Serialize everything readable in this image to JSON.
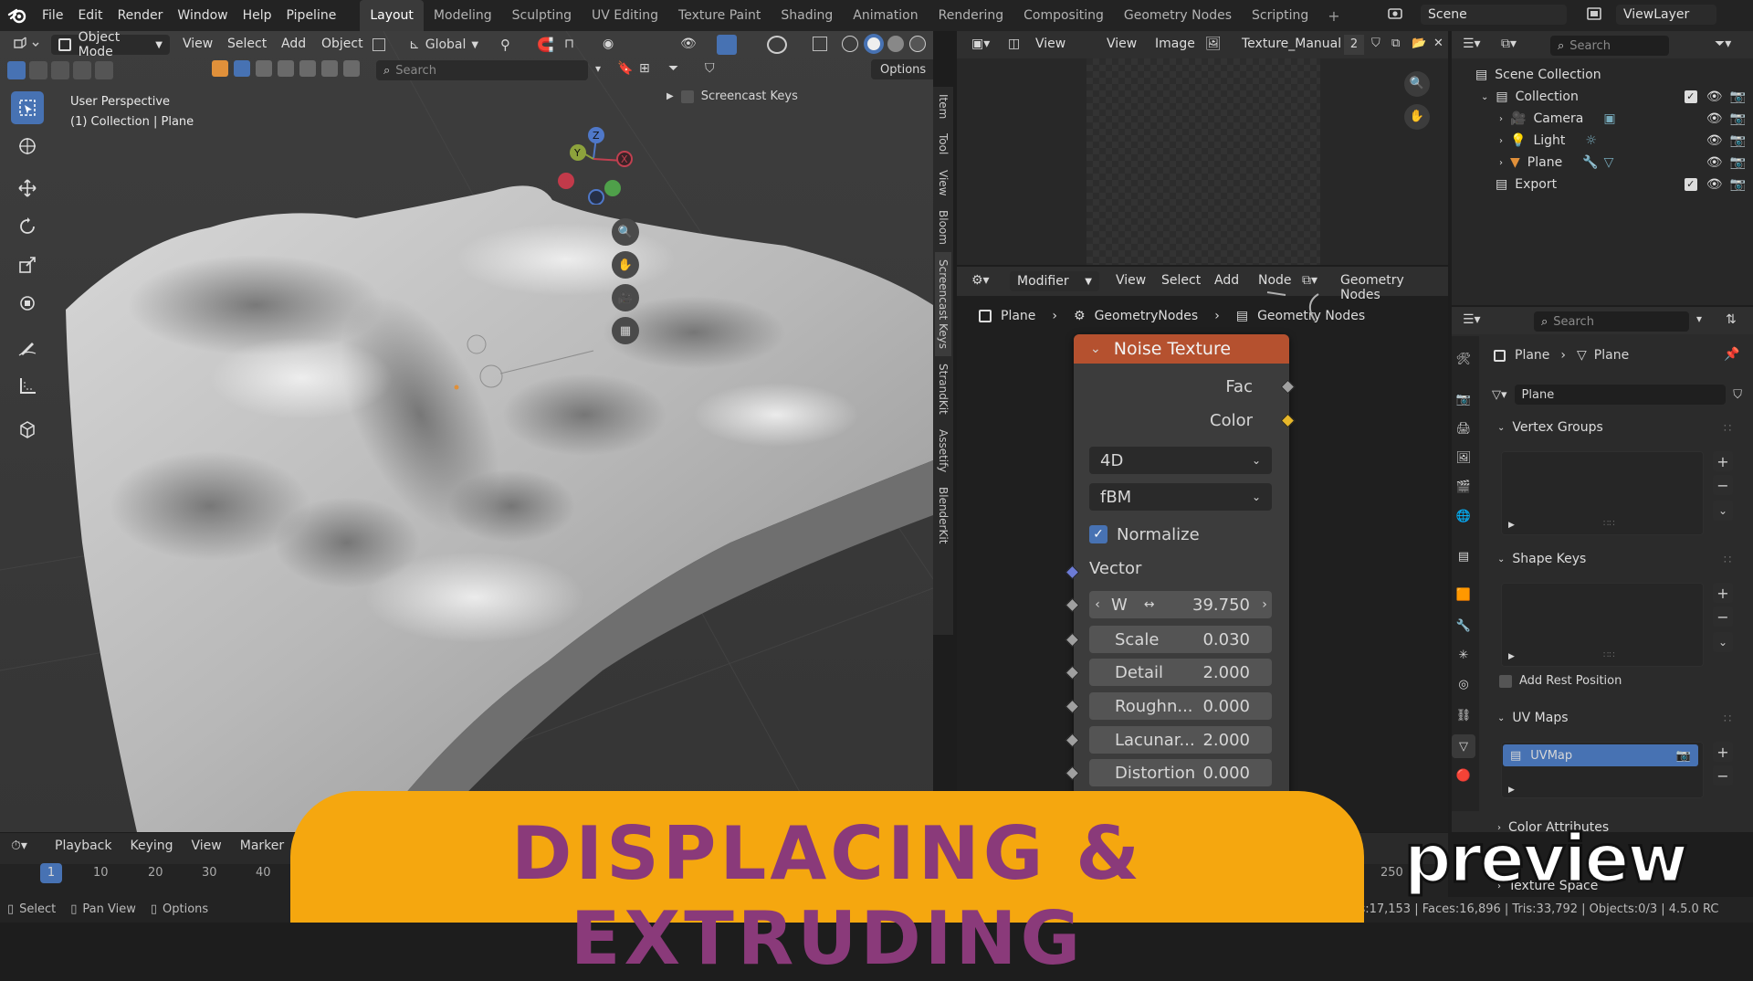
{
  "topbar": {
    "menus": [
      "File",
      "Edit",
      "Render",
      "Window",
      "Help",
      "Pipeline"
    ],
    "workspaces": [
      "Layout",
      "Modeling",
      "Sculpting",
      "UV Editing",
      "Texture Paint",
      "Shading",
      "Animation",
      "Rendering",
      "Compositing",
      "Geometry Nodes",
      "Scripting"
    ],
    "add_tab": "+",
    "scene": "Scene",
    "view_layer": "ViewLayer"
  },
  "viewport": {
    "mode": "Object Mode",
    "menus": [
      "View",
      "Select",
      "Add",
      "Object"
    ],
    "orientation": "Global",
    "search_placeholder": "Search",
    "options": "Options",
    "perspective": "User Perspective",
    "collection_line": "(1) Collection | Plane",
    "screencast": "Screencast Keys",
    "side_tabs": [
      "Item",
      "Tool",
      "View",
      "Bloom",
      "Screencast Keys",
      "StrandKit",
      "Assetify",
      "BlenderKit"
    ],
    "gizmo": {
      "x": "X",
      "y": "Y",
      "z": "Z"
    }
  },
  "image_editor": {
    "menus": [
      "View",
      "Image"
    ],
    "image_name": "Texture_Manual",
    "users": "2"
  },
  "node_editor": {
    "editor": "Modifier",
    "menus": [
      "View",
      "Select",
      "Add",
      "Node"
    ],
    "tree_type": "Geometry Nodes",
    "breadcrumb": [
      "Plane",
      "GeometryNodes",
      "Geometry Nodes"
    ],
    "node": {
      "title": "Noise Texture",
      "outputs": [
        "Fac",
        "Color"
      ],
      "dimensions": "4D",
      "type": "fBM",
      "normalize_label": "Normalize",
      "normalize": true,
      "vector_label": "Vector",
      "inputs": [
        {
          "label": "W",
          "value": "39.750"
        },
        {
          "label": "Scale",
          "value": "0.030"
        },
        {
          "label": "Detail",
          "value": "2.000"
        },
        {
          "label": "Roughn...",
          "value": "0.000"
        },
        {
          "label": "Lacunar...",
          "value": "2.000"
        },
        {
          "label": "Distortion",
          "value": "0.000"
        }
      ]
    }
  },
  "outliner": {
    "search_placeholder": "Search",
    "root": "Scene Collection",
    "items": [
      {
        "name": "Collection"
      },
      {
        "name": "Camera"
      },
      {
        "name": "Light"
      },
      {
        "name": "Plane"
      },
      {
        "name": "Export"
      }
    ]
  },
  "properties": {
    "search_placeholder": "Search",
    "breadcrumb": [
      "Plane",
      "Plane"
    ],
    "mesh_name": "Plane",
    "panels": {
      "vertex_groups": "Vertex Groups",
      "shape_keys": "Shape Keys",
      "add_rest_position": "Add Rest Position",
      "uv_maps": "UV Maps",
      "uvmap": "UVMap",
      "color_attributes": "Color Attributes",
      "texture_space": "Texture Space"
    }
  },
  "timeline": {
    "menus": [
      "Playback",
      "Keying",
      "View",
      "Marker"
    ],
    "frames": [
      "1",
      "10",
      "20",
      "30",
      "40"
    ],
    "end_frame": "250"
  },
  "statusbar": {
    "left": [
      "Select",
      "Pan View",
      "Options"
    ],
    "stats": "erts:17,153 | Faces:16,896 | Tris:33,792 | Objects:0/3 | 4.5.0 RC"
  },
  "overlay": {
    "banner": "DISPLACING & EXTRUDING",
    "preview": "preview"
  },
  "colors": {
    "accent": "#4772b3",
    "node_header": "#b5512f",
    "banner": "#f5a70f",
    "banner_text": "#8a3a7a"
  }
}
